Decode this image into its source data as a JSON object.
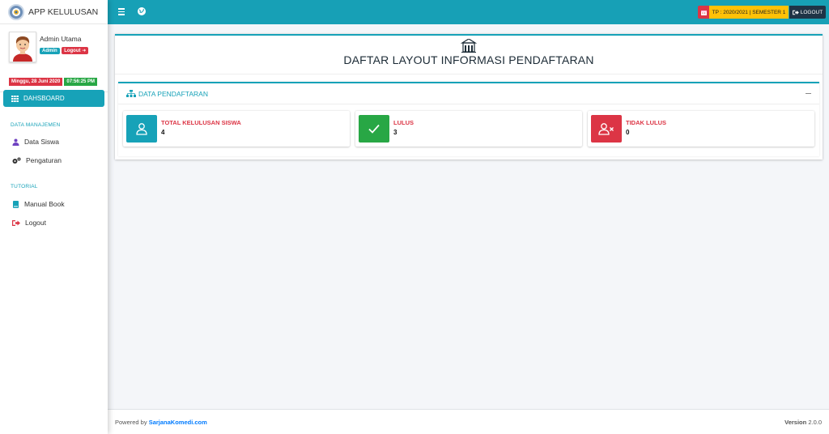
{
  "app": {
    "brand_text": "APP KELULUSAN"
  },
  "user": {
    "name": "Admin Utama",
    "role_badge": "Admin",
    "logout_badge": "Logout"
  },
  "datetime": {
    "date": "Minggu, 28 Juni 2020",
    "time": "07:56:25 PM"
  },
  "sidebar": {
    "active_item": {
      "label": "DAHSBOARD",
      "icon": "grid-icon"
    },
    "sections": [
      {
        "header": "DATA MANAJEMEN",
        "items": [
          {
            "label": "Data Siswa",
            "icon": "users-icon"
          },
          {
            "label": "Pengaturan",
            "icon": "cogs-icon"
          }
        ]
      },
      {
        "header": "TUTORIAL",
        "items": [
          {
            "label": "Manual Book",
            "icon": "book-icon"
          },
          {
            "label": "Logout",
            "icon": "sign-out-icon"
          }
        ]
      }
    ]
  },
  "topbar": {
    "period_text": "TP : 2020/2021 | SEMESTER 1",
    "logout_label": "LOGOUT"
  },
  "main": {
    "page_title": "DAFTAR LAYOUT INFORMASI PENDAFTARAN",
    "panel_title": "DATA PENDAFTARAN",
    "info_boxes": [
      {
        "label": "TOTAL KELULUSAN SISWA",
        "value": "4",
        "color": "#17a2b8",
        "icon": "user-icon"
      },
      {
        "label": "LULUS",
        "value": "3",
        "color": "#28a745",
        "icon": "check-icon"
      },
      {
        "label": "TIDAK LULUS",
        "value": "0",
        "color": "#dc3545",
        "icon": "user-times-icon"
      }
    ]
  },
  "footer": {
    "powered_prefix": "Powered by",
    "powered_link": "SarjanaKomedi.com",
    "version_label": "Version",
    "version_value": "2.0.0"
  },
  "colors": {
    "primary": "#17a2b8",
    "danger": "#dc3545",
    "success": "#28a745",
    "warning": "#ffc107",
    "dark": "#1f3447"
  }
}
